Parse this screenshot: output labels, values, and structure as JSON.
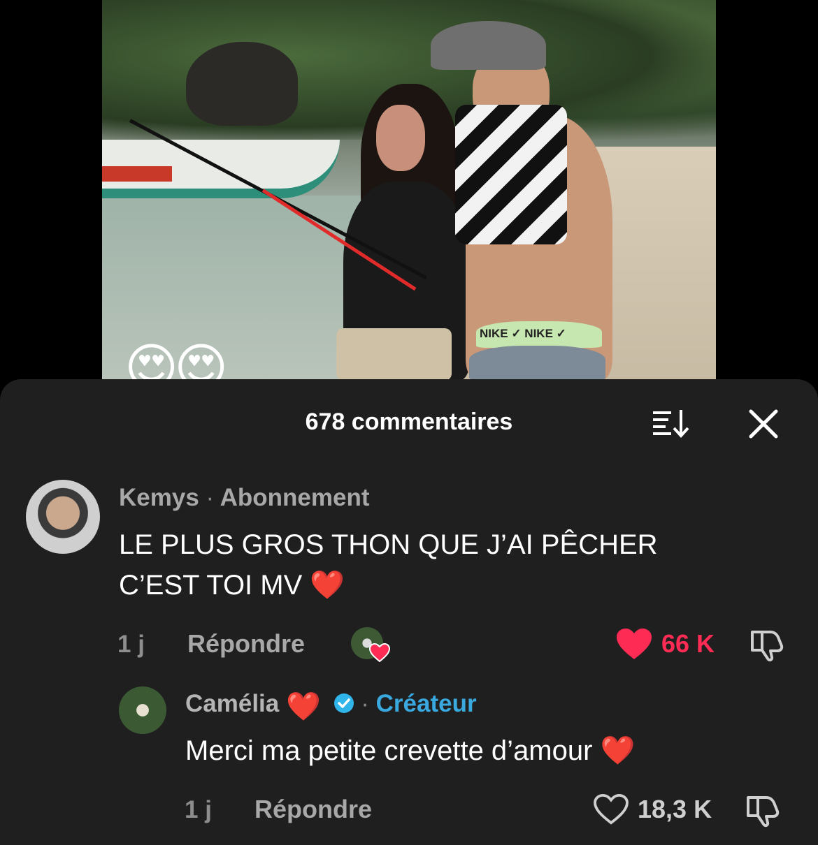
{
  "video": {
    "overlay_emojis": "😍😍",
    "waistband_text": "NIKE ✓   NIKE ✓"
  },
  "sheet": {
    "title": "678 commentaires"
  },
  "comments": [
    {
      "username": "Kemys",
      "separator": "·",
      "badge": "Abonnement",
      "text_line1": "LE PLUS GROS THON QUE J’AI PÊCHER",
      "text_line2": "C’EST TOI MV ❤️",
      "time": "1 j",
      "reply_label": "Répondre",
      "likes": "66 K",
      "liked": true
    },
    {
      "username": "Camélia",
      "username_emoji": "❤️",
      "separator": "·",
      "badge": "Créateur",
      "text": "Merci ma petite crevette d’amour ❤️",
      "time": "1 j",
      "reply_label": "Répondre",
      "likes": "18,3 K",
      "liked": false
    }
  ],
  "colors": {
    "sheet_bg": "#1f1f1f",
    "like_red": "#fe2c55",
    "creator_blue": "#39a9e0"
  },
  "icons": [
    "sort-icon",
    "close-icon",
    "heart-icon",
    "dislike-icon",
    "verified-icon"
  ]
}
